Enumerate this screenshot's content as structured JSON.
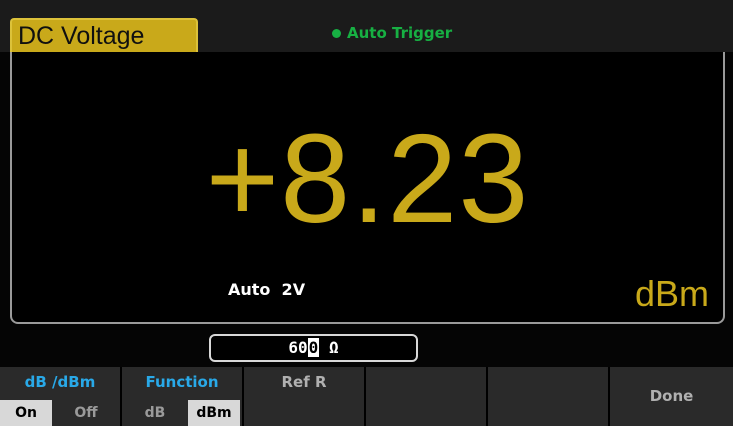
{
  "header": {
    "mode": "DC Voltage",
    "trigger": "Auto Trigger"
  },
  "display": {
    "value": "+8.23",
    "range": "Auto  2V",
    "unit": "dBm"
  },
  "input": {
    "before_cursor": "60",
    "cursor_char": "0",
    "after_cursor": " Ω"
  },
  "softkeys": {
    "db_dbm": {
      "title": "dB /dBm",
      "option_on": "On",
      "option_off": "Off",
      "selected": "On"
    },
    "function": {
      "title": "Function",
      "option_db": "dB",
      "option_dbm": "dBm",
      "selected": "dBm"
    },
    "ref_r": {
      "title": "Ref R"
    },
    "blank1": "",
    "blank2": "",
    "done": {
      "title": "Done"
    }
  },
  "colors": {
    "accent_yellow": "#c9a91a",
    "trigger_green": "#17b043",
    "softkey_blue": "#29a9e8"
  }
}
